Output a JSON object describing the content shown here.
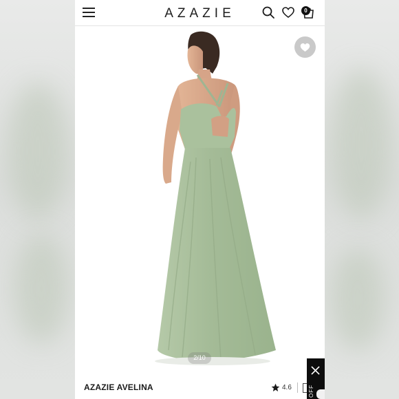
{
  "header": {
    "brand": "AZAZIE",
    "cart_count": "0"
  },
  "icons": {
    "menu": "hamburger-menu-icon",
    "search": "search-icon",
    "wishlist": "heart-icon",
    "cart": "shopping-bag-icon",
    "favorite": "heart-icon",
    "rating": "star-icon",
    "close": "close-icon"
  },
  "gallery": {
    "pager": "2/10"
  },
  "product": {
    "title": "AZAZIE AVELINA",
    "rating": "4.6"
  },
  "promo": {
    "label": "OFF"
  },
  "colors": {
    "dress": "#a9bf9d",
    "accent": "#111111",
    "fav_button": "#c9c9c9"
  }
}
